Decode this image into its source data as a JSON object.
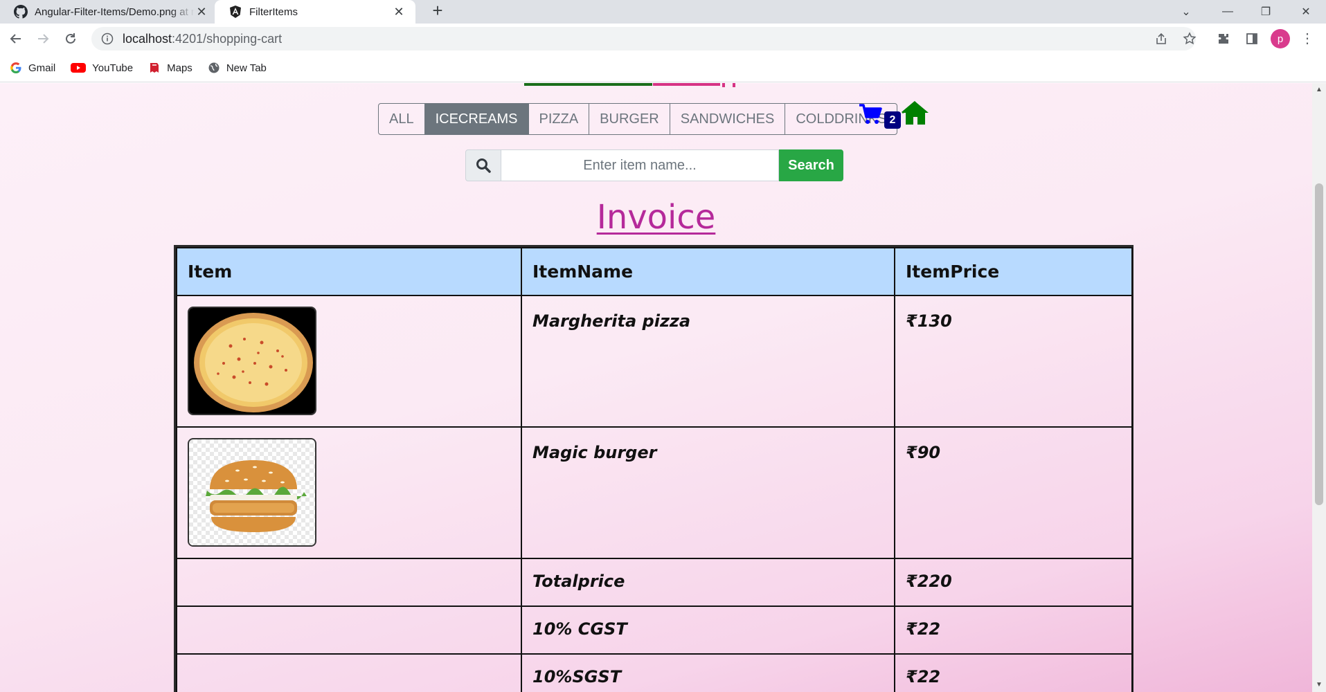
{
  "browser": {
    "tabs": [
      {
        "title": "Angular-Filter-Items/Demo.png at main",
        "icon": "github-icon",
        "active": false
      },
      {
        "title": "FilterItems",
        "icon": "angular-icon",
        "active": true
      }
    ],
    "url_host": "localhost",
    "url_path": ":4201/shopping-cart",
    "profile_initial": "p",
    "bookmarks": [
      {
        "label": "Gmail",
        "icon": "google-icon"
      },
      {
        "label": "YouTube",
        "icon": "youtube-icon"
      },
      {
        "label": "Maps",
        "icon": "maps-icon"
      },
      {
        "label": "New Tab",
        "icon": "globe-icon"
      }
    ]
  },
  "filters": [
    {
      "label": "ALL",
      "active": false
    },
    {
      "label": "ICECREAMS",
      "active": true
    },
    {
      "label": "PIZZA",
      "active": false
    },
    {
      "label": "BURGER",
      "active": false
    },
    {
      "label": "SANDWICHES",
      "active": false
    },
    {
      "label": "COLDDRINKS",
      "active": false
    }
  ],
  "cart": {
    "count": "2",
    "icon": "cart-icon",
    "color": "#0000ff"
  },
  "home": {
    "icon": "home-icon",
    "color": "#008000"
  },
  "search": {
    "placeholder": "Enter item name...",
    "button_label": "Search",
    "icon": "search-icon"
  },
  "invoice": {
    "title": "Invoice",
    "headers": [
      "Item",
      "ItemName",
      "ItemPrice"
    ],
    "items": [
      {
        "name": "Margherita pizza",
        "price": "₹130",
        "image": "pizza"
      },
      {
        "name": "Magic burger",
        "price": "₹90",
        "image": "burger"
      }
    ],
    "summary": [
      {
        "label": "Totalprice",
        "value": "₹220"
      },
      {
        "label": "10% CGST",
        "value": "₹22"
      },
      {
        "label": "10%SGST",
        "value": "₹22"
      }
    ]
  },
  "colors": {
    "title": "#b5299a",
    "header_bg": "#b8daff",
    "search_button": "#28a745",
    "filter_active": "#6c757d"
  }
}
